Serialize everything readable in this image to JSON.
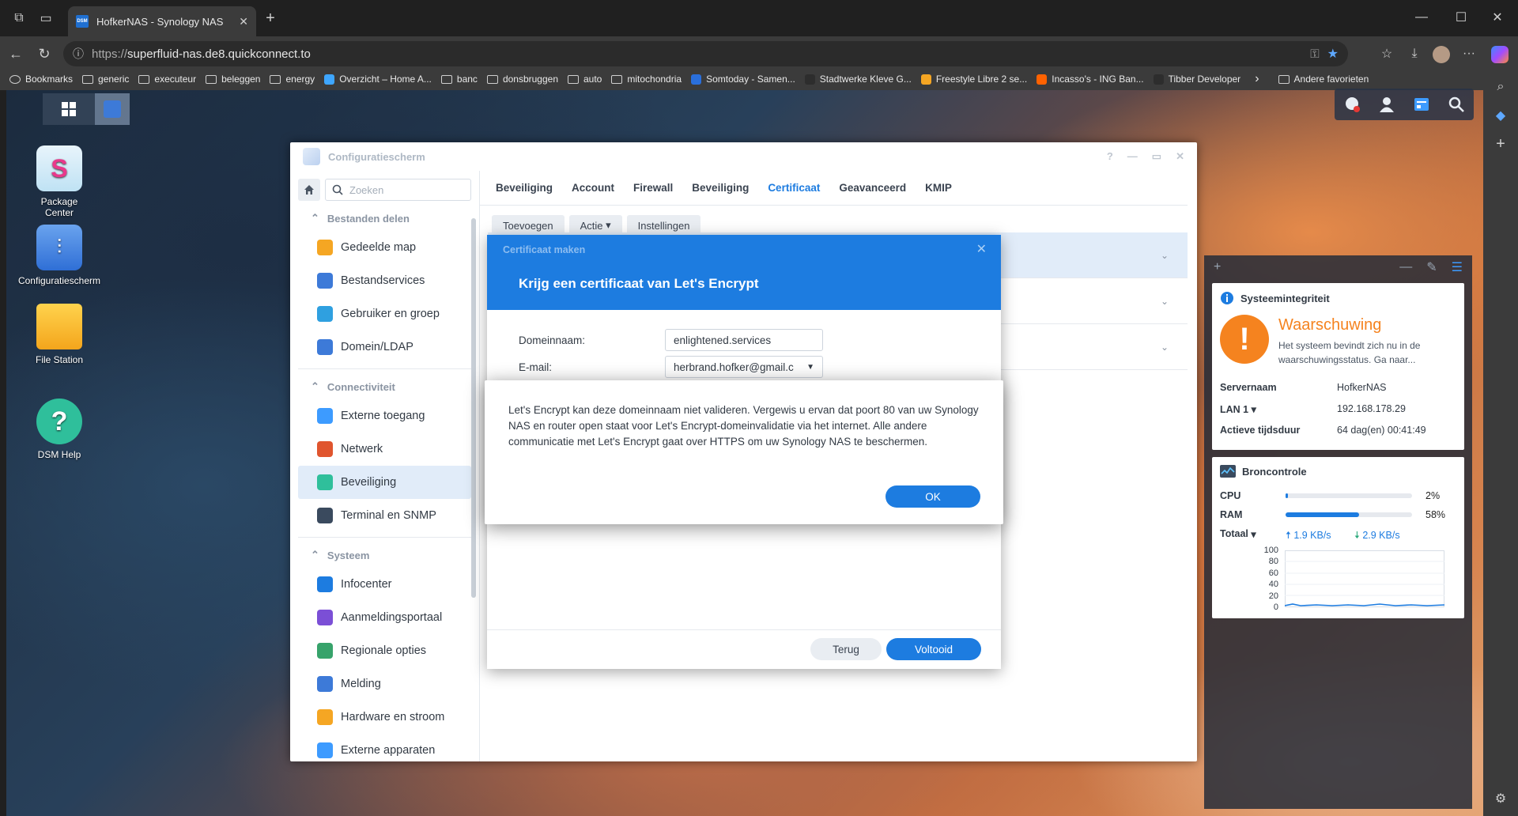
{
  "browser": {
    "tab_title": "HofkerNAS - Synology NAS",
    "url_protocol": "https://",
    "url_rest": "superfluid-nas.de8.quickconnect.to",
    "bookmarks": [
      {
        "label": "Bookmarks",
        "type": "list"
      },
      {
        "label": "generic",
        "type": "folder"
      },
      {
        "label": "executeur",
        "type": "folder"
      },
      {
        "label": "beleggen",
        "type": "folder"
      },
      {
        "label": "energy",
        "type": "folder"
      },
      {
        "label": "Overzicht – Home A...",
        "type": "fav",
        "color": "#3ea6ff"
      },
      {
        "label": "banc",
        "type": "folder"
      },
      {
        "label": "donsbruggen",
        "type": "folder"
      },
      {
        "label": "auto",
        "type": "folder"
      },
      {
        "label": "mitochondria",
        "type": "folder"
      },
      {
        "label": "Somtoday - Samen...",
        "type": "fav",
        "color": "#2a6fdb"
      },
      {
        "label": "Stadtwerke Kleve G...",
        "type": "fav",
        "color": "#2d2d2d"
      },
      {
        "label": "Freestyle Libre 2 se...",
        "type": "fav",
        "color": "#f5a623"
      },
      {
        "label": "Incasso's - ING Ban...",
        "type": "fav",
        "color": "#ff6200"
      },
      {
        "label": "Tibber Developer",
        "type": "fav",
        "color": "#2d2d2d"
      }
    ],
    "other_favorites": "Andere favorieten"
  },
  "desktop": {
    "icons": [
      {
        "label": "Package\nCenter"
      },
      {
        "label": "Configuratiescherm"
      },
      {
        "label": "File Station"
      },
      {
        "label": "DSM Help"
      }
    ]
  },
  "control_panel": {
    "title": "Configuratiescherm",
    "search_placeholder": "Zoeken",
    "sections": [
      {
        "title": "Bestanden delen",
        "items": [
          "Gedeelde map",
          "Bestandservices",
          "Gebruiker en groep",
          "Domein/LDAP"
        ]
      },
      {
        "title": "Connectiviteit",
        "items": [
          "Externe toegang",
          "Netwerk",
          "Beveiliging",
          "Terminal en SNMP"
        ]
      },
      {
        "title": "Systeem",
        "items": [
          "Infocenter",
          "Aanmeldingsportaal",
          "Regionale opties",
          "Melding",
          "Hardware en stroom",
          "Externe apparaten"
        ]
      }
    ],
    "tabs": [
      "Beveiliging",
      "Account",
      "Firewall",
      "Beveiliging",
      "Certificaat",
      "Geavanceerd",
      "KMIP"
    ],
    "active_tab": "Certificaat",
    "sub_buttons": [
      "Toevoegen",
      "Actie",
      "Instellingen"
    ]
  },
  "wizard": {
    "small_title": "Certificaat maken",
    "title": "Krijg een certificaat van Let's Encrypt",
    "domain_label": "Domeinnaam:",
    "domain_value": "enlightened.services",
    "email_label": "E-mail:",
    "email_value": "herbrand.hofker@gmail.c",
    "back_label": "Terug",
    "finish_label": "Voltooid"
  },
  "alert": {
    "message": "Let's Encrypt kan deze domeinnaam niet valideren. Vergewis u ervan dat poort 80 van uw Synology NAS en router open staat voor Let's Encrypt-domeinvalidatie via het internet. Alle andere communicatie met Let's Encrypt gaat over HTTPS om uw Synology NAS te beschermen.",
    "ok_label": "OK"
  },
  "widgets": {
    "health": {
      "title": "Systeemintegriteit",
      "status": "Waarschuwing",
      "status_color": "#f5831f",
      "description": "Het systeem bevindt zich nu in de waarschuwingsstatus. Ga naar...",
      "server_label": "Servernaam",
      "server_value": "HofkerNAS",
      "lan_label": "LAN 1",
      "lan_value": "192.168.178.29",
      "uptime_label": "Actieve tijdsduur",
      "uptime_value": "64 dag(en) 00:41:49"
    },
    "resource": {
      "title": "Broncontrole",
      "cpu_label": "CPU",
      "cpu_value": "2%",
      "cpu_fraction": 0.02,
      "ram_label": "RAM",
      "ram_value": "58%",
      "ram_fraction": 0.58,
      "total_label": "Totaal",
      "upload": "1.9 KB/s",
      "download": "2.9 KB/s",
      "y_ticks": [
        "100",
        "80",
        "60",
        "40",
        "20",
        "0"
      ]
    }
  }
}
